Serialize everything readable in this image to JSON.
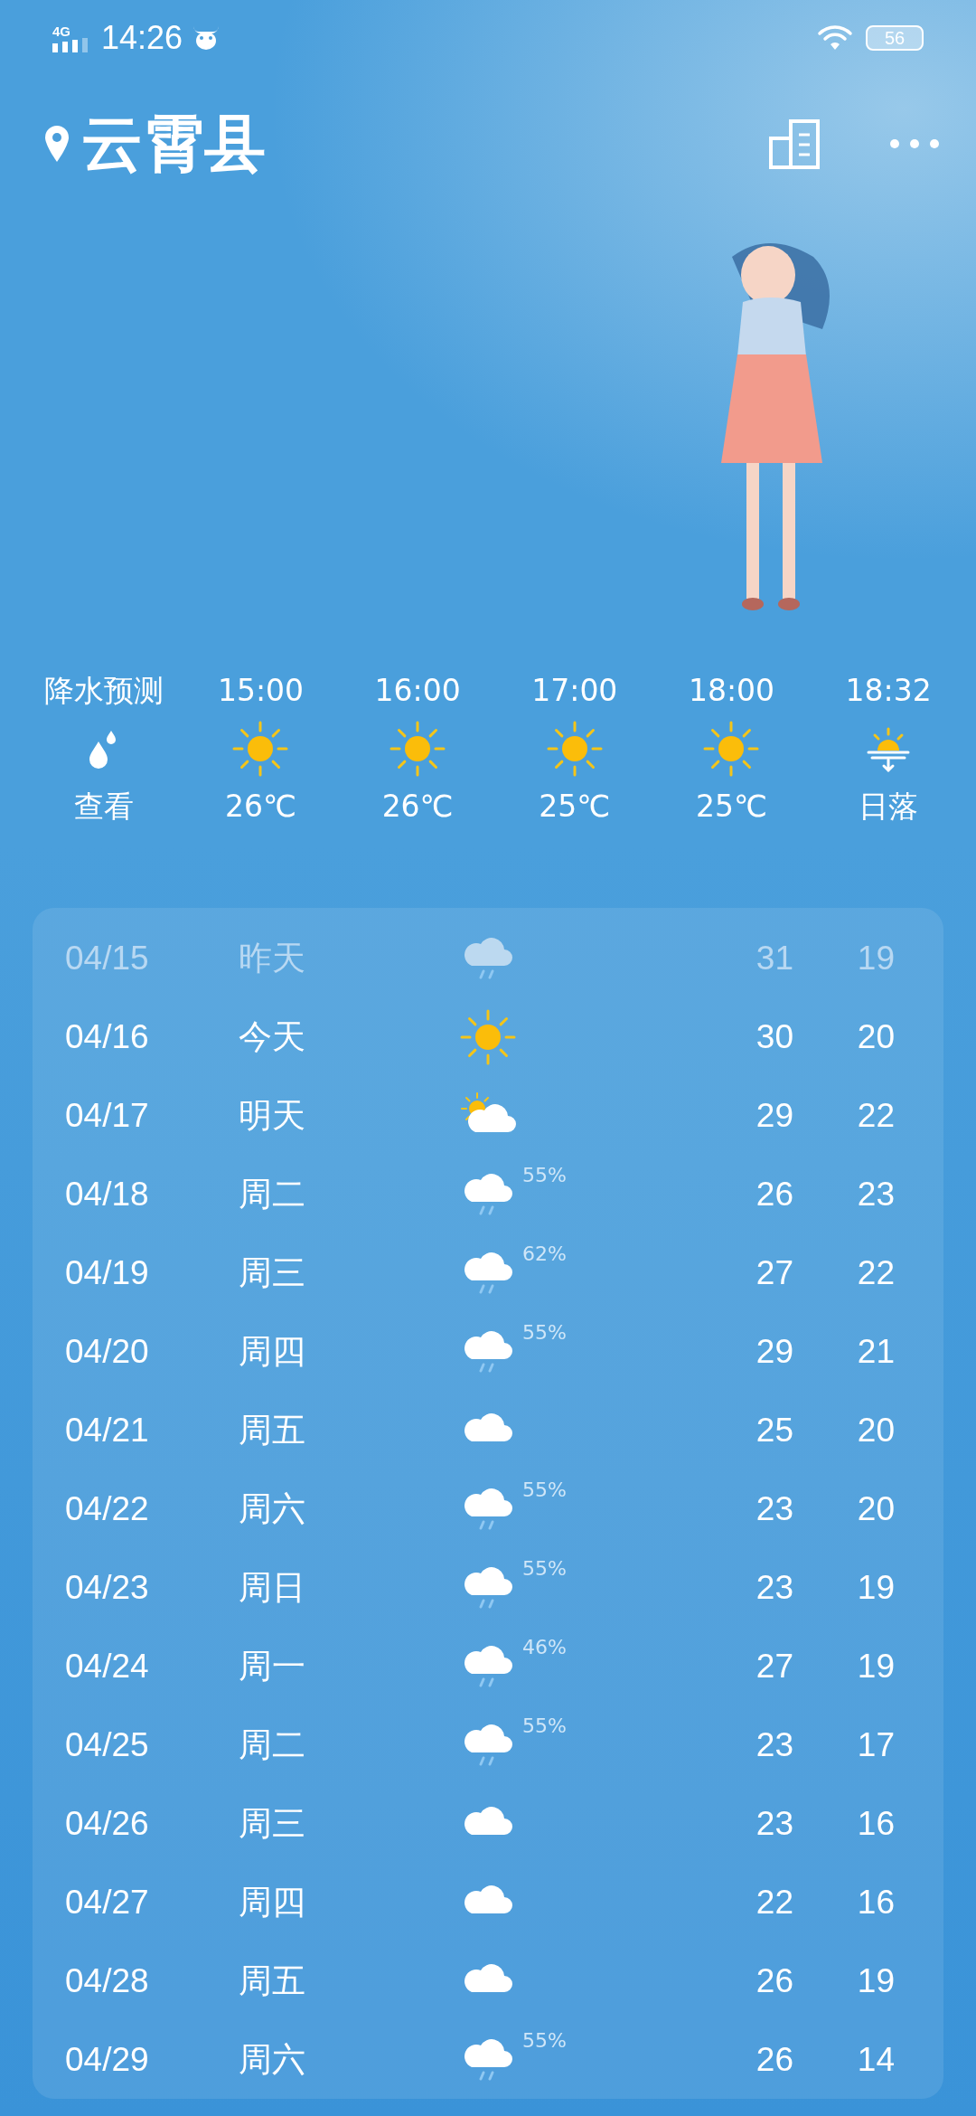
{
  "status_bar": {
    "network": "4G",
    "time": "14:26",
    "battery": "56"
  },
  "header": {
    "city": "云霄县"
  },
  "hourly": [
    {
      "kind": "precip",
      "top": "降水预测",
      "bottom": "查看"
    },
    {
      "kind": "sunny",
      "top": "15:00",
      "bottom": "26℃"
    },
    {
      "kind": "sunny",
      "top": "16:00",
      "bottom": "26℃"
    },
    {
      "kind": "sunny",
      "top": "17:00",
      "bottom": "25℃"
    },
    {
      "kind": "sunny",
      "top": "18:00",
      "bottom": "25℃"
    },
    {
      "kind": "sunset",
      "top": "18:32",
      "bottom": "日落"
    }
  ],
  "daily": [
    {
      "date": "04/15",
      "day": "昨天",
      "kind": "rain",
      "high": "31",
      "low": "19",
      "past": true
    },
    {
      "date": "04/16",
      "day": "今天",
      "kind": "sunny",
      "high": "30",
      "low": "20",
      "past": false
    },
    {
      "date": "04/17",
      "day": "明天",
      "kind": "partly",
      "high": "29",
      "low": "22",
      "past": false
    },
    {
      "date": "04/18",
      "day": "周二",
      "kind": "rain",
      "chance": "55%",
      "high": "26",
      "low": "23",
      "past": false
    },
    {
      "date": "04/19",
      "day": "周三",
      "kind": "rain",
      "chance": "62%",
      "high": "27",
      "low": "22",
      "past": false
    },
    {
      "date": "04/20",
      "day": "周四",
      "kind": "rain",
      "chance": "55%",
      "high": "29",
      "low": "21",
      "past": false
    },
    {
      "date": "04/21",
      "day": "周五",
      "kind": "cloudy",
      "high": "25",
      "low": "20",
      "past": false
    },
    {
      "date": "04/22",
      "day": "周六",
      "kind": "rain",
      "chance": "55%",
      "high": "23",
      "low": "20",
      "past": false
    },
    {
      "date": "04/23",
      "day": "周日",
      "kind": "rain",
      "chance": "55%",
      "high": "23",
      "low": "19",
      "past": false
    },
    {
      "date": "04/24",
      "day": "周一",
      "kind": "rain",
      "chance": "46%",
      "high": "27",
      "low": "19",
      "past": false
    },
    {
      "date": "04/25",
      "day": "周二",
      "kind": "rain",
      "chance": "55%",
      "high": "23",
      "low": "17",
      "past": false
    },
    {
      "date": "04/26",
      "day": "周三",
      "kind": "cloudy",
      "high": "23",
      "low": "16",
      "past": false
    },
    {
      "date": "04/27",
      "day": "周四",
      "kind": "cloudy",
      "high": "22",
      "low": "16",
      "past": false
    },
    {
      "date": "04/28",
      "day": "周五",
      "kind": "cloudy",
      "high": "26",
      "low": "19",
      "past": false
    },
    {
      "date": "04/29",
      "day": "周六",
      "kind": "rain",
      "chance": "55%",
      "high": "26",
      "low": "14",
      "past": false
    }
  ]
}
